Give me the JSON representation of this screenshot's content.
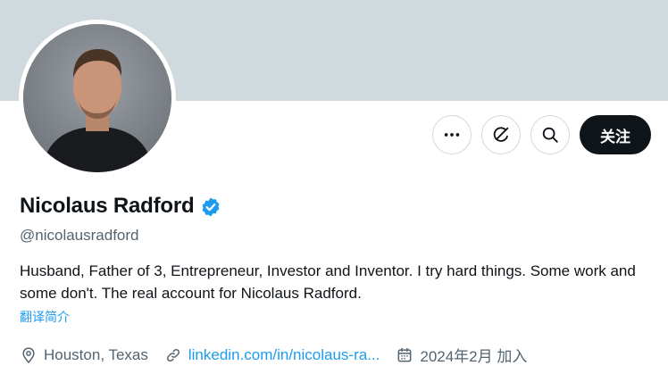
{
  "profile": {
    "name": "Nicolaus Radford",
    "handle": "@nicolausradford",
    "bio": "Husband, Father of 3, Entrepreneur, Investor and Inventor. I try hard things. Some work and some don't. The real account for Nicolaus Radford.",
    "translate_label": "翻译简介",
    "verified": true
  },
  "actions": {
    "more_icon": "more-horizontal-icon",
    "grok_icon": "grok-icon",
    "search_icon": "search-icon",
    "follow_label": "关注"
  },
  "meta": {
    "location": "Houston, Texas",
    "website": "linkedin.com/in/nicolaus-ra...",
    "joined": "2024年2月 加入"
  },
  "colors": {
    "banner": "#cfd9de",
    "accent": "#1d9bf0",
    "follow_bg": "#0f1419",
    "secondary_text": "#536471"
  }
}
